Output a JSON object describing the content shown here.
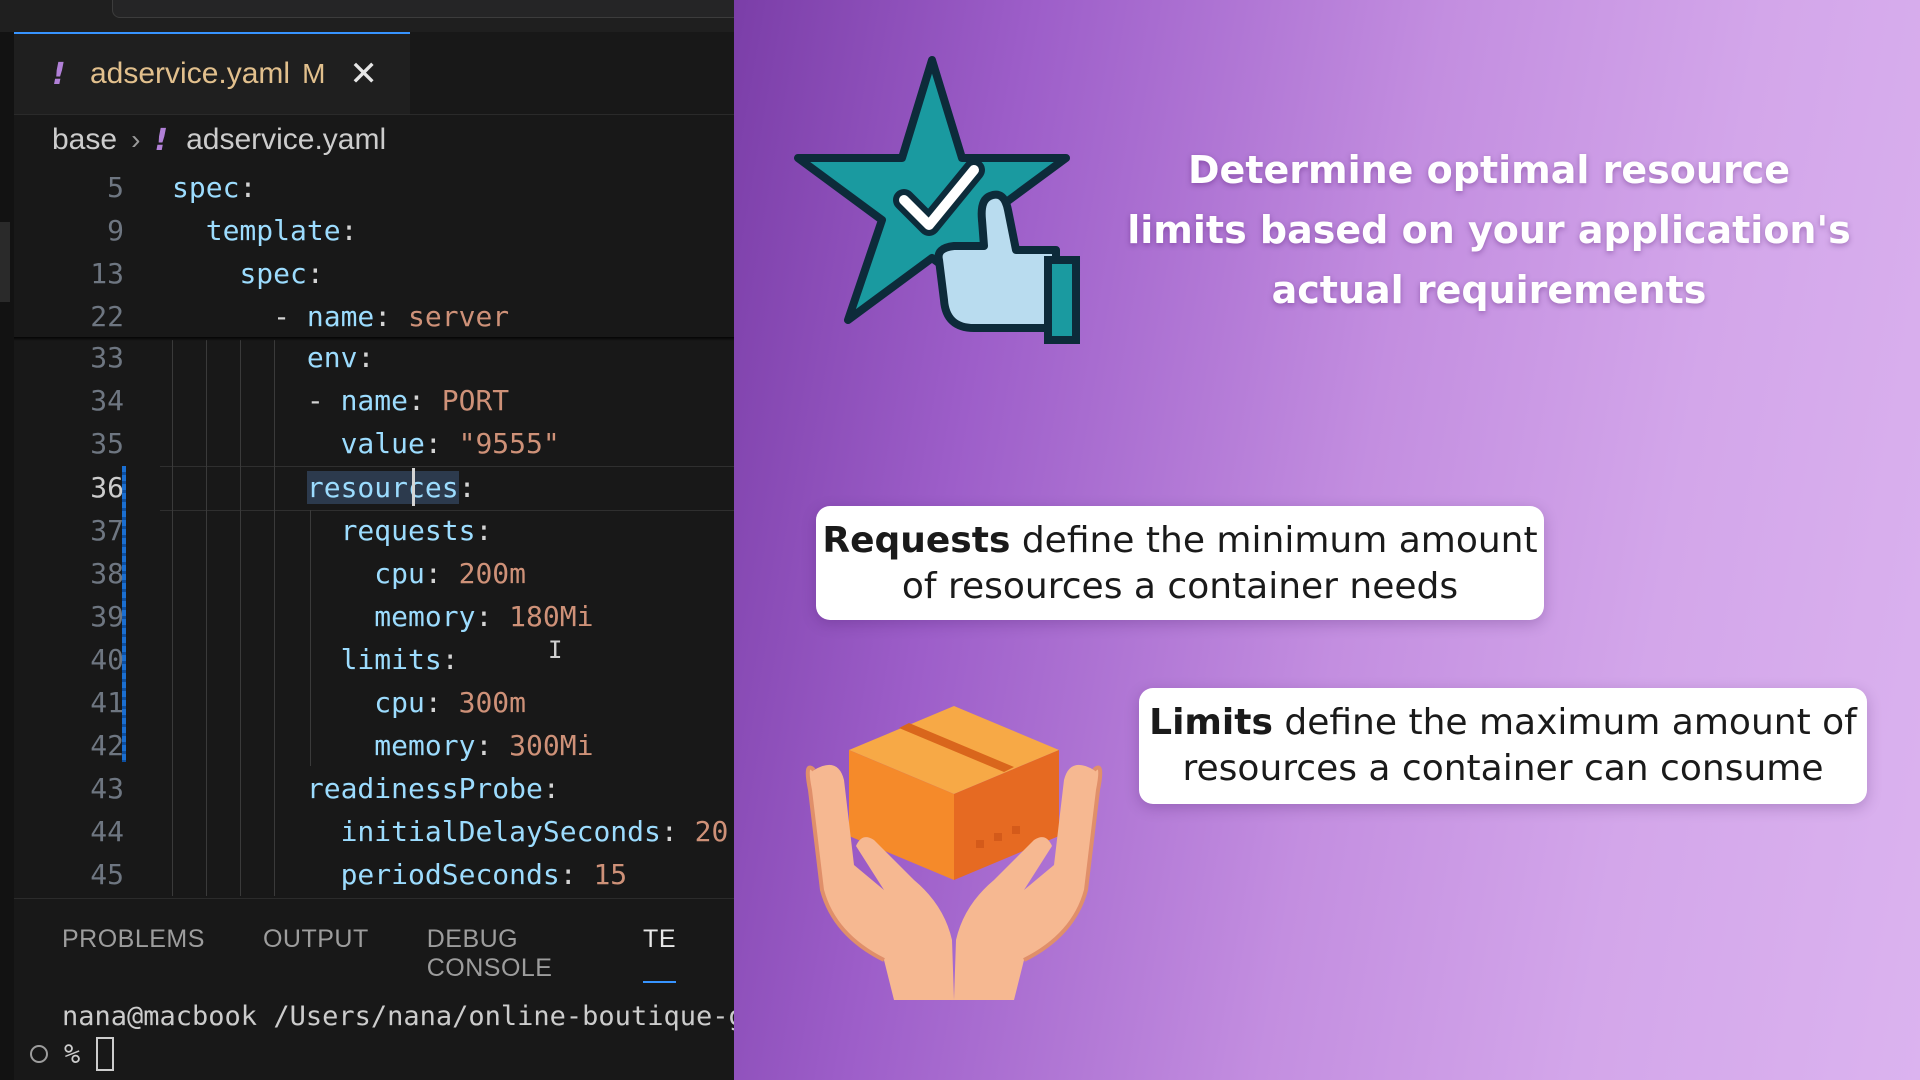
{
  "editor": {
    "tab": {
      "icon": "yaml-exclamation-icon",
      "bang": "!",
      "filename": "adservice.yaml",
      "badge": "M",
      "close": "✕"
    },
    "breadcrumb": {
      "folder": "base",
      "separator": "›",
      "bang": "!",
      "file": "adservice.yaml"
    },
    "lines": [
      {
        "num": "5",
        "key": "spec",
        "indent": ""
      },
      {
        "num": "9",
        "key": "template",
        "indent": "  "
      },
      {
        "num": "13",
        "key": "spec",
        "indent": "    "
      },
      {
        "num": "22",
        "key": "name",
        "value": "server",
        "indent": "      - "
      },
      {
        "num": "33",
        "key": "env",
        "indent": "        "
      },
      {
        "num": "34",
        "key": "name",
        "value": "PORT",
        "indent": "        - "
      },
      {
        "num": "35",
        "key": "value",
        "value": "\"9555\"",
        "indent": "          "
      },
      {
        "num": "36",
        "key": "resources",
        "indent": "        "
      },
      {
        "num": "37",
        "key": "requests",
        "indent": "          "
      },
      {
        "num": "38",
        "key": "cpu",
        "value": "200m",
        "indent": "            "
      },
      {
        "num": "39",
        "key": "memory",
        "value": "180Mi",
        "indent": "            "
      },
      {
        "num": "40",
        "key": "limits",
        "indent": "          "
      },
      {
        "num": "41",
        "key": "cpu",
        "value": "300m",
        "indent": "            "
      },
      {
        "num": "42",
        "key": "memory",
        "value": "300Mi",
        "indent": "            "
      },
      {
        "num": "43",
        "key": "readinessProbe",
        "indent": "        "
      },
      {
        "num": "44",
        "key": "initialDelaySeconds",
        "value": "20",
        "indent": "          "
      },
      {
        "num": "45",
        "key": "periodSeconds",
        "value": "15",
        "indent": "          "
      }
    ],
    "active_line": "36",
    "panel": {
      "tabs": [
        "PROBLEMS",
        "OUTPUT",
        "DEBUG CONSOLE",
        "TE"
      ],
      "active_tab": "TE",
      "terminal_line": "nana@macbook /Users/nana/online-boutique-g",
      "prompt": "%"
    }
  },
  "slide": {
    "headline": "Determine optimal resource limits based on your application's actual requirements",
    "requests_card": {
      "bold": "Requests",
      "rest": " define the minimum amount of resources a container needs"
    },
    "limits_card": {
      "bold": "Limits",
      "rest": " define the maximum amount of resources a container can consume"
    },
    "icons": {
      "top": "star-thumbs-up-icon",
      "bottom": "hands-holding-box-icon"
    },
    "colors": {
      "gradient_start": "#7b3ea8",
      "gradient_end": "#dbb3ef",
      "star": "#1a9aa0",
      "box": "#f58a2a"
    }
  }
}
